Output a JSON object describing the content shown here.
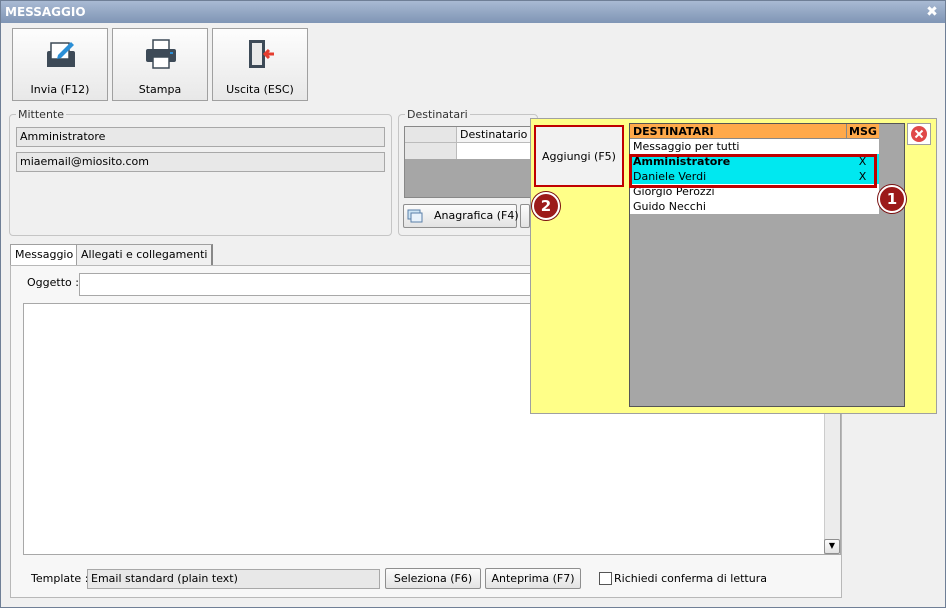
{
  "window": {
    "title": "MESSAGGIO",
    "close_glyph": "✖"
  },
  "toolbar": {
    "send_label": "Invia (F12)",
    "print_label": "Stampa",
    "exit_label": "Uscita (ESC)"
  },
  "mittente": {
    "legend": "Mittente",
    "name": "Amministratore",
    "email": "miaemail@miosito.com"
  },
  "destinatari": {
    "legend": "Destinatari",
    "column_header": "Destinatario",
    "anagrafica_label": "Anagrafica (F4)"
  },
  "tabs": [
    {
      "label": "Messaggio"
    },
    {
      "label": "Allegati e collegamenti"
    }
  ],
  "message": {
    "subject_label": "Oggetto :",
    "subject_value": "",
    "body": ""
  },
  "footer": {
    "template_label": "Template :",
    "template_value": "Email standard (plain text)",
    "select_label": "Seleziona (F6)",
    "preview_label": "Anteprima (F7)",
    "read_receipt_label": "Richiedi conferma di lettura",
    "read_receipt_checked": false
  },
  "popup": {
    "add_label": "Aggiungi (F5)",
    "list_header": "DESTINATARI",
    "msg_header": "MSG",
    "rows": [
      {
        "name": "Messaggio per tutti",
        "msg": "",
        "selected": false
      },
      {
        "name": "Amministratore",
        "msg": "X",
        "selected": true
      },
      {
        "name": "Daniele Verdi",
        "msg": "X",
        "selected": true
      },
      {
        "name": "Giorgio Perozzi",
        "msg": "",
        "selected": false
      },
      {
        "name": "Guido Necchi",
        "msg": "",
        "selected": false
      }
    ],
    "badges": [
      "1",
      "2"
    ]
  },
  "colors": {
    "highlight_border": "#c00000",
    "popup_bg": "#ffff88",
    "list_header_bg": "#ffa94a",
    "selected_row_bg": "#00e8f0",
    "badge_bg": "#9c1a1a"
  }
}
